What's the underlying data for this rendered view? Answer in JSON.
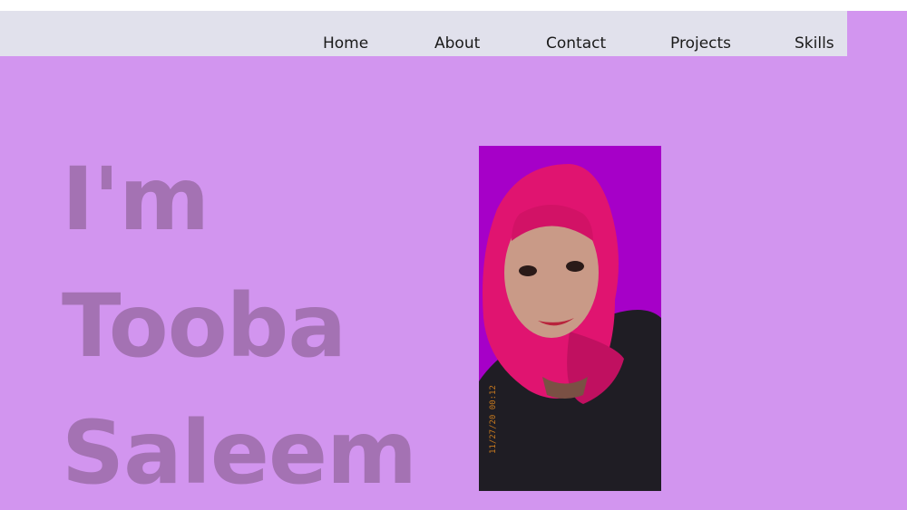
{
  "nav": {
    "items": [
      {
        "label": "Home"
      },
      {
        "label": "About"
      },
      {
        "label": "Contact"
      },
      {
        "label": "Projects"
      },
      {
        "label": "Skills"
      }
    ]
  },
  "hero": {
    "line1": "I'm",
    "line2": "Tooba",
    "line3": "Saleem"
  },
  "photo": {
    "timestamp": "11/27/20 00:12"
  },
  "colors": {
    "background": "#d295ef",
    "navbar": "#e1e1ec",
    "headline": "#a472b3",
    "photo_backdrop": "#a600c8",
    "hijab": "#e01470"
  }
}
